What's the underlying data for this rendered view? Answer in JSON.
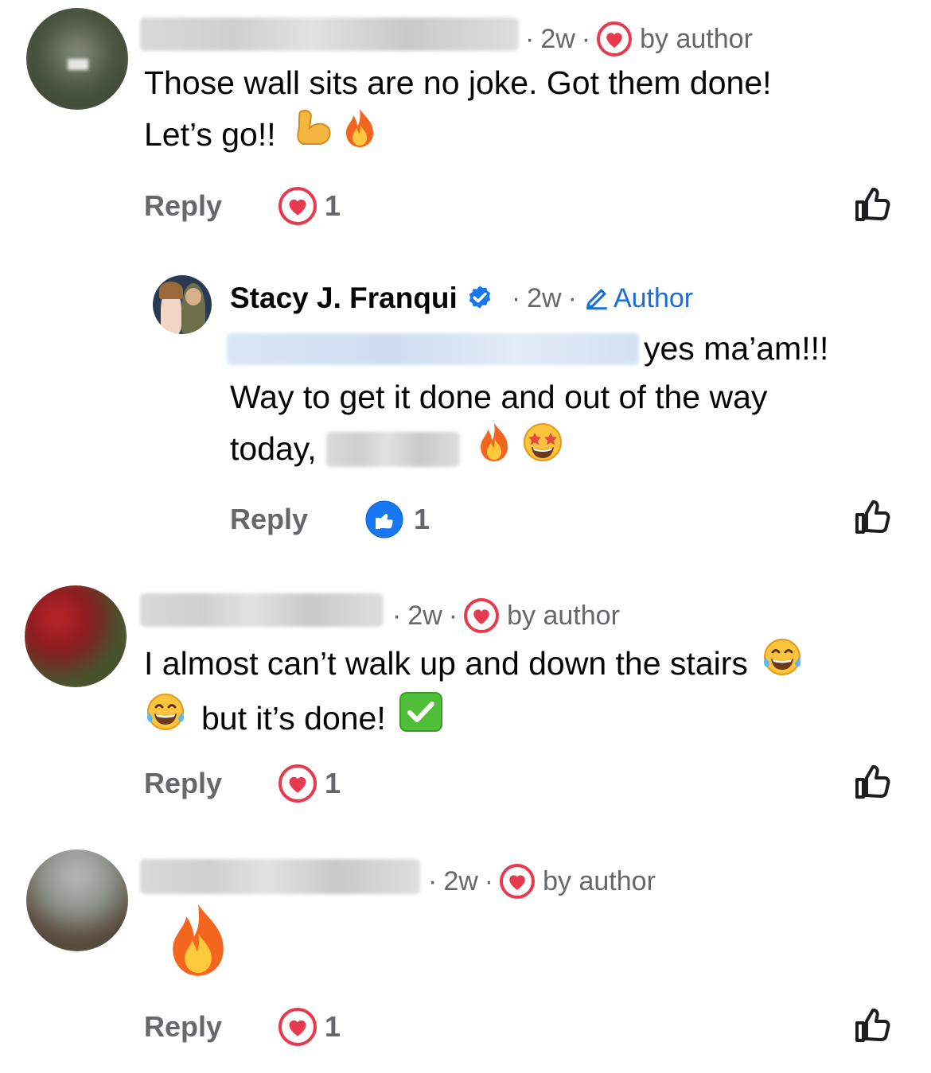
{
  "comments": [
    {
      "time": "2w",
      "badge": "by author",
      "text_line1": "Those wall sits are no joke. Got them done!",
      "text_line2": "Let’s go!!",
      "reply_label": "Reply",
      "reaction_count": "1",
      "reaction_icon": "heart-reaction-icon"
    },
    {
      "time": "2w",
      "badge": "by author",
      "text_line1": "I almost can’t walk up and down the stairs",
      "text_line2": "but it’s done!",
      "reply_label": "Reply",
      "reaction_count": "1",
      "reaction_icon": "heart-reaction-icon"
    },
    {
      "time": "2w",
      "badge": "by author",
      "reply_label": "Reply",
      "reaction_count": "1",
      "reaction_icon": "heart-reaction-icon"
    }
  ],
  "author_reply": {
    "name": "Stacy J. Franqui",
    "time": "2w",
    "tag": "Author",
    "text_line1_suffix": "yes ma’am!!!",
    "text_line2": "Way to get it done and out of the way",
    "text_line3_prefix": "today,",
    "reply_label": "Reply",
    "reaction_count": "1",
    "reaction_icon": "like-reaction-icon"
  },
  "colors": {
    "heart": "#e83a4f",
    "like": "#1877f2",
    "author_blue": "#1b6dd8",
    "meta_gray": "#65676b"
  }
}
